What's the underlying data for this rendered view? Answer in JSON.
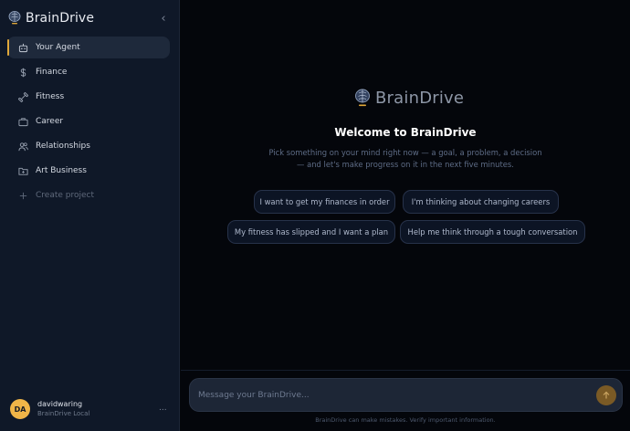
{
  "sidebar": {
    "brand": "BrainDrive",
    "collapse_icon": "chevron-left-icon",
    "items": [
      {
        "label": "Your Agent",
        "icon": "robot-icon",
        "active": true
      },
      {
        "label": "Finance",
        "icon": "dollar-icon",
        "active": false
      },
      {
        "label": "Fitness",
        "icon": "dumbbell-icon",
        "active": false
      },
      {
        "label": "Career",
        "icon": "briefcase-icon",
        "active": false
      },
      {
        "label": "Relationships",
        "icon": "people-icon",
        "active": false
      },
      {
        "label": "Art Business",
        "icon": "folder-icon",
        "active": false
      }
    ],
    "create_label": "Create project",
    "user": {
      "initials": "DA",
      "name": "davidwaring",
      "subtitle": "BrainDrive Local",
      "more": "..."
    }
  },
  "main": {
    "brand": "BrainDrive",
    "welcome": "Welcome to BrainDrive",
    "subtitle": "Pick something on your mind right now — a goal, a problem, a decision — and let's make progress on it in the next five minutes.",
    "suggestions": [
      "I want to get my finances in order",
      "I'm thinking about changing careers",
      "My fitness has slipped and I want a plan",
      "Help me think through a tough conversation"
    ],
    "composer_placeholder": "Message your BrainDrive...",
    "disclaimer": "BrainDrive can make mistakes. Verify important information."
  },
  "colors": {
    "accent": "#e0a83a",
    "avatar": "#f0b548",
    "sidebar_bg": "#0f1828",
    "main_bg": "#04060b"
  }
}
